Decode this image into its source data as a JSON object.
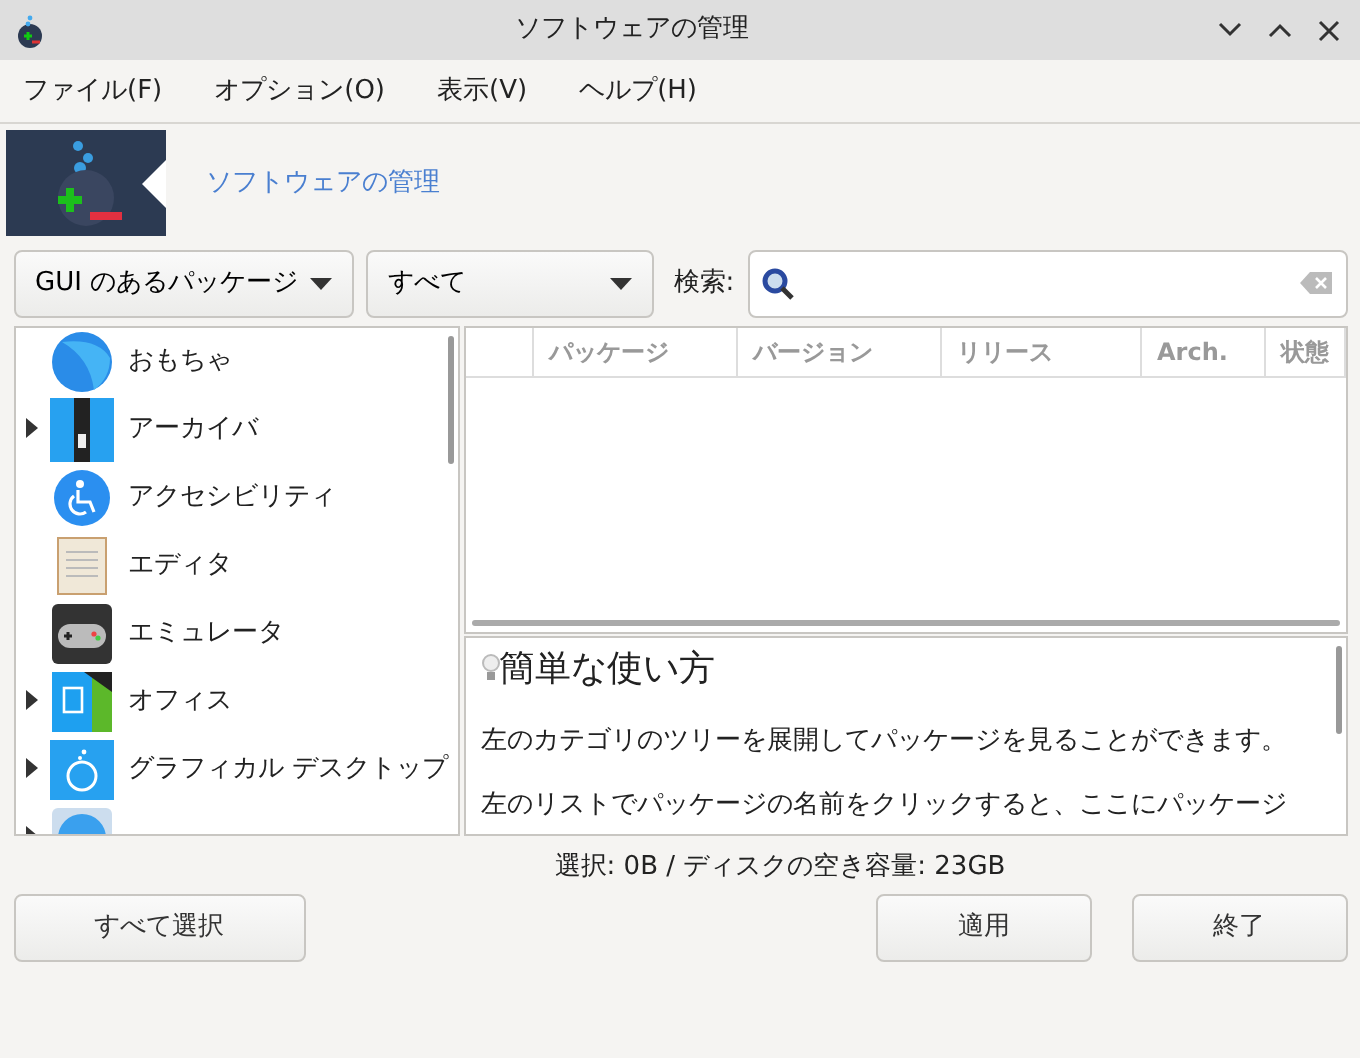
{
  "window": {
    "title": "ソフトウェアの管理"
  },
  "menu": [
    "ファイル(F)",
    "オプション(O)",
    "表示(V)",
    "ヘルプ(H)"
  ],
  "banner": {
    "title": "ソフトウェアの管理"
  },
  "filters": [
    {
      "label": "GUI のあるパッケージ"
    },
    {
      "label": "すべて"
    }
  ],
  "search": {
    "label": "検索:"
  },
  "categories": [
    {
      "label": "おもちゃ",
      "expandable": false
    },
    {
      "label": "アーカイバ",
      "expandable": true
    },
    {
      "label": "アクセシビリティ",
      "expandable": false
    },
    {
      "label": "エディタ",
      "expandable": false
    },
    {
      "label": "エミュレータ",
      "expandable": false
    },
    {
      "label": "オフィス",
      "expandable": true
    },
    {
      "label": "グラフィカル デスクトップ",
      "expandable": true
    },
    {
      "expandable": true
    }
  ],
  "table": {
    "columns": [
      "パッケージ",
      "バージョン",
      "リリース",
      "Arch.",
      "状態"
    ]
  },
  "help": {
    "title": "簡単な使い方",
    "paragraphs": [
      "左のカテゴリのツリーを展開してパッケージを見ることができます。",
      "左のリストでパッケージの名前をクリックすると、ここにパッケージ"
    ]
  },
  "status_bar": "選択: 0B / ディスクの空き容量: 23GB",
  "buttons": {
    "select_all": "すべて選択",
    "apply": "適用",
    "quit": "終了"
  }
}
